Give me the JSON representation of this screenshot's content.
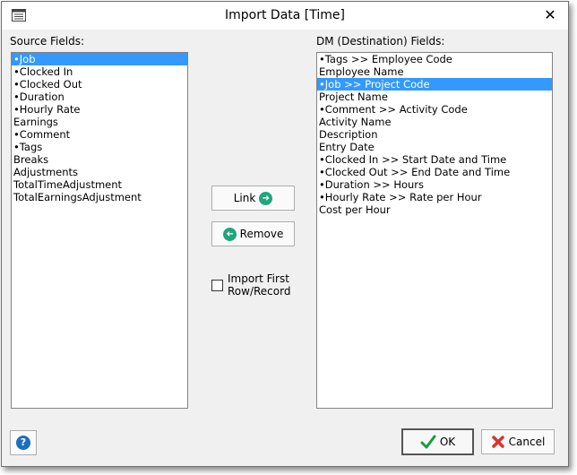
{
  "window": {
    "title": "Import Data [Time]",
    "close_glyph": "✕"
  },
  "source": {
    "label": "Source Fields:",
    "items": [
      "•Job",
      "•Clocked In",
      "•Clocked Out",
      "•Duration",
      "•Hourly Rate",
      "Earnings",
      "•Comment",
      "•Tags",
      "Breaks",
      "Adjustments",
      "TotalTimeAdjustment",
      "TotalEarningsAdjustment"
    ],
    "selected_index": 0
  },
  "destination": {
    "label": "DM (Destination) Fields:",
    "items": [
      "•Tags >> Employee Code",
      "Employee Name",
      "•Job >> Project Code",
      "Project Name",
      "•Comment >> Activity Code",
      "Activity Name",
      "Description",
      "Entry Date",
      "•Clocked In >> Start Date and Time",
      "•Clocked Out >> End Date and Time",
      "•Duration >> Hours",
      "•Hourly Rate >> Rate per Hour",
      "Cost per Hour"
    ],
    "selected_index": 2
  },
  "actions": {
    "link_label": "Link",
    "remove_label": "Remove",
    "link_icon": "arrow-right-icon",
    "remove_icon": "arrow-left-icon"
  },
  "import_first_row": {
    "label": "Import First Row/Record",
    "checked": false
  },
  "footer": {
    "help_icon": "help-icon",
    "help_glyph": "?",
    "ok_label": "OK",
    "cancel_label": "Cancel",
    "ok_icon": "checkmark-icon",
    "cancel_icon": "red-x-icon"
  },
  "colors": {
    "selection": "#3399ff",
    "link_icon": "#1fa67a",
    "ok_check": "#1a9c3e",
    "cancel_x": "#d9342b"
  }
}
